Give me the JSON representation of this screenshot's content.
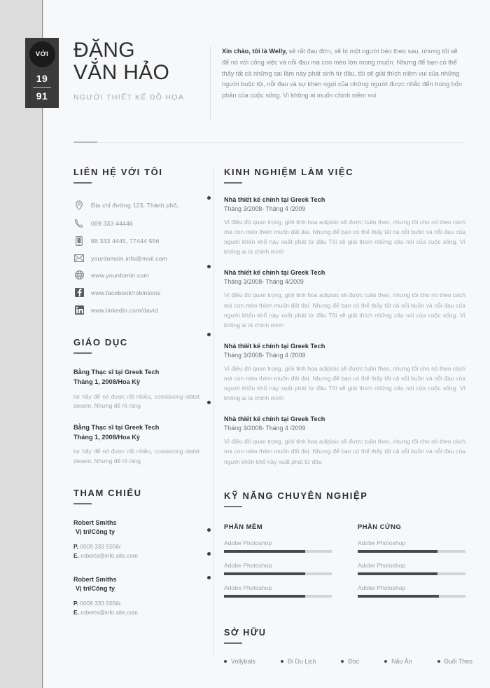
{
  "header": {
    "badge": {
      "label": "VỚI",
      "year_top": "19",
      "year_bottom": "91"
    },
    "first_name": "ĐẶNG",
    "last_name": "VĂN HẢO",
    "job_title": "NGƯỜI THIẾT KẾ ĐỒ HỌA",
    "intro_lead": "Xin chào, tôi là Welly,",
    "intro_body": " sẽ rất đau đớn, sẽ bị một người béo theo sau, nhưng tôi sẽ để nó với công việc và nỗi đau mà con mèo lớn mong muốn. Nhưng để bạn có thể thấy tất cả những sai lầm này phát sinh từ đâu, tôi sẽ giải thích niềm vui của những người buộc tội, nỗi đau và sự khen ngợi của những người được nhắc đến trong bốn phần của cuộc sống. Vì không ai muốn chinh niềm vui"
  },
  "contact": {
    "heading": "LIÊN HỆ VỚI TÔI",
    "items": [
      {
        "icon": "location-pin-icon",
        "text": "Địa chỉ đường 123, Thành phố,"
      },
      {
        "icon": "phone-icon",
        "text": "009 333 44446"
      },
      {
        "icon": "mobile-icon",
        "text": "88    333    4445,   77444    556"
      },
      {
        "icon": "envelope-icon",
        "text": "yourdomain.info@mail.com"
      },
      {
        "icon": "globe-icon",
        "text": "www.yourdomin.com"
      },
      {
        "icon": "facebook-icon",
        "text": "www.facebook/robinsons"
      },
      {
        "icon": "linkedin-icon",
        "text": "www.linkedin.com/david"
      }
    ]
  },
  "education": {
    "heading": "GIÁO DỤC",
    "items": [
      {
        "degree": "Bằng Thạc sĩ tại Greek Tech",
        "date": "Tháng 1, 2008/Hoa Kỳ",
        "desc": "lor hãy để nó được rất nhiều, consisicing idatat desem. Nhưng để rõ ràng"
      },
      {
        "degree": "Bằng Thạc sĩ tại Greek Tech",
        "date": "Tháng 1, 2008/Hoa Kỳ",
        "desc": "lor hãy để nó được rất nhiều, consisicing idatat desem. Nhưng để rõ ràng"
      }
    ]
  },
  "references": {
    "heading": "THAM CHIẾU",
    "items": [
      {
        "name": "Robert Smiths",
        "role": "Vị trí/Công ty",
        "phone_label": "P.",
        "phone": "0009 333 5556r",
        "email_label": "E.",
        "email": "roberts@info.site.com"
      },
      {
        "name": "Robert Smiths",
        "role": "Vị trí/Công ty",
        "phone_label": "P.",
        "phone": "0009 333 5556r",
        "email_label": "E.",
        "email": "roberts@info.site.com"
      }
    ]
  },
  "experience": {
    "heading": "KINH NGHIỆM LÀM VIỆC",
    "items": [
      {
        "role": "Nhà thiết kế chính tại Greek Tech",
        "date": "Tháng 3/2008- Tháng 4 /2009",
        "desc": "Vì điều đó quan trọng, giới tinh hoa adipisic sẽ được tuân theo, nhưng tôi cho nó theo cách mà con mèo thèm muốn đất đai. Nhưng để bạn có thể thấy tất cả nỗi buồn và nỗi đau của người khốn khổ này xuất phát từ đâu Tôi sẽ giải thích những câu nói của cuộc sống. Vì không ai là chính mình"
      },
      {
        "role": "Nhà thiết kế chính tại Greek Tech",
        "date": "Tháng 3/2008- Tháng 4/2009",
        "desc": "Vì điều đó quan trọng, giới tinh hoa adipisic sẽ được tuân theo, nhưng tôi cho nó theo cách mà con mèo thèm muốn đất đai. Nhưng để bạn có thể thấy tất cả nỗi buồn và nỗi đau của người khốn khổ này xuất phát từ đâu Tôi sẽ giải thích những câu nói của cuộc sống. Vì không ai là chính mình"
      },
      {
        "role": "Nhà thiết kế chính tại Greek Tech",
        "date": "Tháng 3/2008- Tháng 4 /2009",
        "desc": "Vì điều đó quan trọng, giới tinh hoa adipisic sẽ được tuân theo, nhưng tôi cho nó theo cách mà con mèo thèm muốn đất đai. Nhưng để bạn có thể thấy tất cả nỗi buồn và nỗi đau của người khốn khổ này xuất phát từ đâu Tôi sẽ giải thích những câu nói của cuộc sống. Vì không ai là chính mình"
      },
      {
        "role": "Nhà thiết kế chính tại Greek Tech",
        "date": "Tháng 3/2008- Tháng 4 /2009",
        "desc": "Vì điều đó quan trọng, giới tinh hoa adipisic sẽ được tuân theo, nhưng tôi cho nó theo cách mà con mèo thèm muốn đất đai. Nhưng để bạn có thể thấy tất cả nỗi buồn và nỗi đau của người khốn khổ này xuất phát từ đâu"
      }
    ]
  },
  "skills": {
    "heading": "KỸ NĂNG CHUYÊN NGHIỆP",
    "software": {
      "heading": "PHẦN MỀM",
      "items": [
        {
          "name": "Adobe Photoshop",
          "value": 75
        },
        {
          "name": "Adobe Photoshop",
          "value": 75
        },
        {
          "name": "Adobe Photoshop",
          "value": 75
        }
      ]
    },
    "hardware": {
      "heading": "PHẦN CỨNG",
      "items": [
        {
          "name": "Adobe Photoshop",
          "value": 74
        },
        {
          "name": "Adobe Photoshop",
          "value": 74
        },
        {
          "name": "Adobe Photoshop",
          "value": 75
        }
      ]
    }
  },
  "hobbies": {
    "heading": "SỞ HỮU",
    "items": [
      "Vollybals",
      "Đi Du Lịch",
      "Đọc",
      "Nấu Ăn",
      "Đuổi Theo"
    ]
  },
  "colors": {
    "page_bg": "#f7f8fa",
    "outer_bg": "#dcdcdc",
    "badge": "#3a3a3a",
    "badge_circle": "#1b1b1b",
    "ink": "#2e2e2e",
    "muted": "#a6a7ab",
    "bar_fill": "#48494c",
    "bar_track": "#d3d4d6"
  }
}
